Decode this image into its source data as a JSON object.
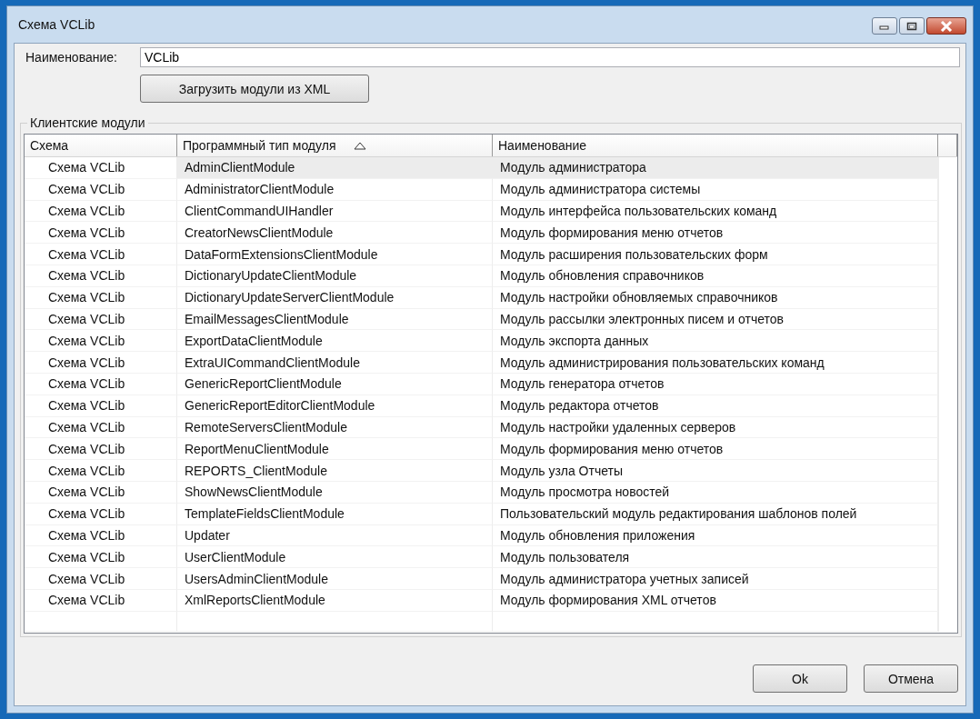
{
  "window": {
    "title": "Схема VCLib"
  },
  "name_field": {
    "label": "Наименование:",
    "value": "VCLib"
  },
  "load_button": "Загрузить модули из XML",
  "group": {
    "title": "Клиентские модули",
    "columns": [
      {
        "label": "Схема",
        "sorted": false
      },
      {
        "label": "Программный тип модуля",
        "sorted": true
      },
      {
        "label": "Наименование",
        "sorted": false
      }
    ],
    "rows": [
      {
        "schema": "Схема VCLib",
        "type": "AdminClientModule",
        "name": "Модуль администратора",
        "selected": true
      },
      {
        "schema": "Схема VCLib",
        "type": "AdministratorClientModule",
        "name": "Модуль администратора системы",
        "selected": false
      },
      {
        "schema": "Схема VCLib",
        "type": "ClientCommandUIHandler",
        "name": "Модуль интерфейса пользовательских команд",
        "selected": false
      },
      {
        "schema": "Схема VCLib",
        "type": "CreatorNewsClientModule",
        "name": "Модуль формирования меню отчетов",
        "selected": false
      },
      {
        "schema": "Схема VCLib",
        "type": "DataFormExtensionsClientModule",
        "name": "Модуль расширения пользовательских форм",
        "selected": false
      },
      {
        "schema": "Схема VCLib",
        "type": "DictionaryUpdateClientModule",
        "name": "Модуль обновления справочников",
        "selected": false
      },
      {
        "schema": "Схема VCLib",
        "type": "DictionaryUpdateServerClientModule",
        "name": "Модуль настройки обновляемых справочников",
        "selected": false
      },
      {
        "schema": "Схема VCLib",
        "type": "EmailMessagesClientModule",
        "name": "Модуль рассылки электронных писем и отчетов",
        "selected": false
      },
      {
        "schema": "Схема VCLib",
        "type": "ExportDataClientModule",
        "name": "Модуль экспорта данных",
        "selected": false
      },
      {
        "schema": "Схема VCLib",
        "type": "ExtraUICommandClientModule",
        "name": "Модуль администрирования пользовательских команд",
        "selected": false
      },
      {
        "schema": "Схема VCLib",
        "type": "GenericReportClientModule",
        "name": "Модуль генератора отчетов",
        "selected": false
      },
      {
        "schema": "Схема VCLib",
        "type": "GenericReportEditorClientModule",
        "name": "Модуль редактора отчетов",
        "selected": false
      },
      {
        "schema": "Схема VCLib",
        "type": "RemoteServersClientModule",
        "name": "Модуль настройки удаленных серверов",
        "selected": false
      },
      {
        "schema": "Схема VCLib",
        "type": "ReportMenuClientModule",
        "name": "Модуль формирования меню отчетов",
        "selected": false
      },
      {
        "schema": "Схема VCLib",
        "type": "REPORTS_ClientModule",
        "name": "Модуль узла Отчеты",
        "selected": false
      },
      {
        "schema": "Схема VCLib",
        "type": "ShowNewsClientModule",
        "name": "Модуль просмотра новостей",
        "selected": false
      },
      {
        "schema": "Схема VCLib",
        "type": "TemplateFieldsClientModule",
        "name": "Пользовательский модуль редактирования шаблонов полей",
        "selected": false
      },
      {
        "schema": "Схема VCLib",
        "type": "Updater",
        "name": "Модуль обновления приложения",
        "selected": false
      },
      {
        "schema": "Схема VCLib",
        "type": "UserClientModule",
        "name": "Модуль пользователя",
        "selected": false
      },
      {
        "schema": "Схема VCLib",
        "type": "UsersAdminClientModule",
        "name": "Модуль администратора учетных записей",
        "selected": false
      },
      {
        "schema": "Схема VCLib",
        "type": "XmlReportsClientModule",
        "name": "Модуль формирования XML отчетов",
        "selected": false
      }
    ]
  },
  "buttons": [
    "Ok",
    "Отмена"
  ]
}
